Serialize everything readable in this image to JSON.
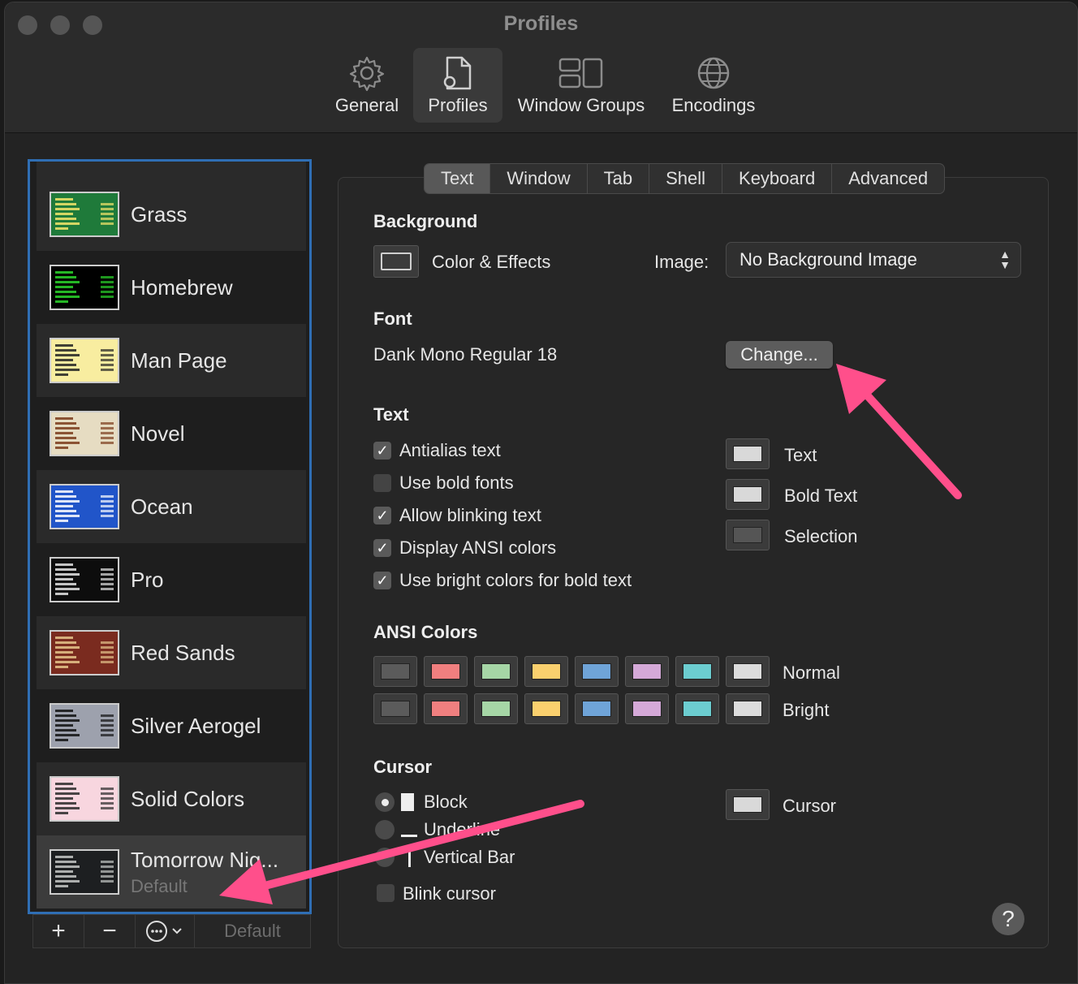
{
  "window": {
    "title": "Profiles"
  },
  "toolbar": {
    "general": "General",
    "profiles": "Profiles",
    "window_groups": "Window Groups",
    "encodings": "Encodings"
  },
  "profiles": [
    {
      "name": "Grass",
      "colors": {
        "bg": "#1f7a3a",
        "fg": "#f5e66b"
      }
    },
    {
      "name": "Homebrew",
      "colors": {
        "bg": "#000000",
        "fg": "#2bd62b"
      }
    },
    {
      "name": "Man Page",
      "colors": {
        "bg": "#f8eda0",
        "fg": "#222222"
      }
    },
    {
      "name": "Novel",
      "colors": {
        "bg": "#e6dcc2",
        "fg": "#7a3b1b"
      }
    },
    {
      "name": "Ocean",
      "colors": {
        "bg": "#2155c9",
        "fg": "#ffffff"
      }
    },
    {
      "name": "Pro",
      "colors": {
        "bg": "#0d0d0d",
        "fg": "#e6e6e6"
      }
    },
    {
      "name": "Red Sands",
      "colors": {
        "bg": "#7a2b1f",
        "fg": "#e6c58c"
      }
    },
    {
      "name": "Silver Aerogel",
      "colors": {
        "bg": "#9da1ad",
        "fg": "#111111"
      }
    },
    {
      "name": "Solid Colors",
      "colors": {
        "bg": "#f8d6df",
        "fg": "#2a2a2a"
      }
    },
    {
      "name": "Tomorrow Nig...",
      "subtitle": "Default",
      "colors": {
        "bg": "#1d1f21",
        "fg": "#c5c8c6"
      }
    }
  ],
  "list_footer": {
    "add": "+",
    "remove": "−",
    "default_label": "Default"
  },
  "tabs": [
    "Text",
    "Window",
    "Tab",
    "Shell",
    "Keyboard",
    "Advanced"
  ],
  "background": {
    "heading": "Background",
    "color_effects": "Color & Effects",
    "image_label": "Image:",
    "image_value": "No Background Image"
  },
  "font": {
    "heading": "Font",
    "value": "Dank Mono Regular 18",
    "change_button": "Change..."
  },
  "text": {
    "heading": "Text",
    "options": [
      {
        "label": "Antialias text",
        "checked": true
      },
      {
        "label": "Use bold fonts",
        "checked": false
      },
      {
        "label": "Allow blinking text",
        "checked": true
      },
      {
        "label": "Display ANSI colors",
        "checked": true
      },
      {
        "label": "Use bright colors for bold text",
        "checked": true
      }
    ],
    "colors": [
      {
        "label": "Text",
        "color": "#d9d9d9"
      },
      {
        "label": "Bold Text",
        "color": "#d9d9d9"
      },
      {
        "label": "Selection",
        "color": "#555555"
      }
    ]
  },
  "ansi": {
    "heading": "ANSI Colors",
    "normal_label": "Normal",
    "bright_label": "Bright",
    "normal": [
      "#5b5b5b",
      "#f07f7f",
      "#a6d6a6",
      "#fad06e",
      "#6fa4d8",
      "#d5a9d8",
      "#6ccdd0",
      "#dcdcdc"
    ],
    "bright": [
      "#5b5b5b",
      "#f07f7f",
      "#a6d6a6",
      "#fad06e",
      "#6fa4d8",
      "#d5a9d8",
      "#6ccdd0",
      "#dcdcdc"
    ]
  },
  "cursor": {
    "heading": "Cursor",
    "options": [
      {
        "label": "Block",
        "selected": true
      },
      {
        "label": "Underline",
        "selected": false
      },
      {
        "label": "Vertical Bar",
        "selected": false
      }
    ],
    "blink": "Blink cursor",
    "color_label": "Cursor",
    "color": "#d9d9d9"
  },
  "help": "?",
  "annotation_color": "#ff4f8b"
}
